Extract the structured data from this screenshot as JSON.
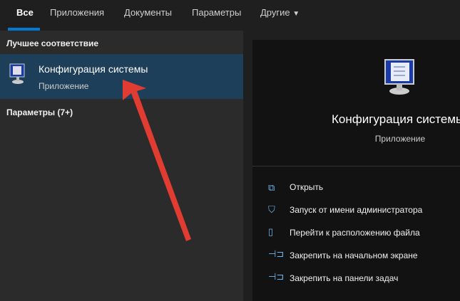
{
  "tabs": [
    {
      "label": "Все"
    },
    {
      "label": "Приложения"
    },
    {
      "label": "Документы"
    },
    {
      "label": "Параметры"
    },
    {
      "label": "Другие"
    }
  ],
  "left": {
    "best_match": "Лучшее соответствие",
    "result": {
      "title": "Конфигурация системы",
      "subtitle": "Приложение"
    },
    "settings": "Параметры (7+)"
  },
  "right": {
    "title": "Конфигурация системы",
    "subtitle": "Приложение",
    "actions": [
      {
        "label": "Открыть",
        "icon": "open-icon"
      },
      {
        "label": "Запуск от имени администратора",
        "icon": "shield-icon"
      },
      {
        "label": "Перейти к расположению файла",
        "icon": "file-location-icon"
      },
      {
        "label": "Закрепить на начальном экране",
        "icon": "pin-icon"
      },
      {
        "label": "Закрепить на панели задач",
        "icon": "pin-icon"
      }
    ]
  },
  "colors": {
    "accent": "#0078d4",
    "selected": "#1e3f5a",
    "arrow": "#e03c31"
  }
}
